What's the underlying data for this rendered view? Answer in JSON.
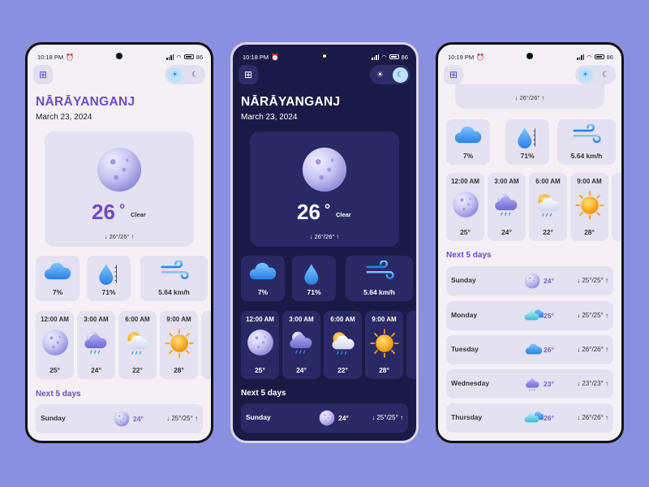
{
  "status": {
    "p1_time": "10:18 PM",
    "p2_time": "10:18 PM",
    "p3_time": "10:19 PM",
    "battery": "86"
  },
  "location": {
    "city": "NĀRĀYANGANJ",
    "date": "March 23, 2024"
  },
  "current": {
    "temp": "26",
    "deg": "°",
    "condition": "Clear",
    "range": "↓ 26°/26° ↑"
  },
  "stats": {
    "cloud": "7%",
    "humidity": "71%",
    "wind": "5.64 km/h"
  },
  "hourly": [
    {
      "time": "12:00 AM",
      "temp": "25°",
      "icon": "moon-icon"
    },
    {
      "time": "3:00 AM",
      "temp": "24°",
      "icon": "cloudy-moon-rain-icon"
    },
    {
      "time": "6:00 AM",
      "temp": "22°",
      "icon": "sun-cloud-rain-icon"
    },
    {
      "time": "9:00 AM",
      "temp": "28°",
      "icon": "sun-icon"
    }
  ],
  "next_title": "Next 5 days",
  "days": [
    {
      "name": "Sunday",
      "temp": "24°",
      "range": "↓ 25°/25° ↑",
      "icon": "moon-icon"
    },
    {
      "name": "Monday",
      "temp": "25°",
      "range": "↓ 25°/25° ↑",
      "icon": "cloudy-icon"
    },
    {
      "name": "Tuesday",
      "temp": "26°",
      "range": "↓ 26°/26° ↑",
      "icon": "cloud-icon"
    },
    {
      "name": "Wednesday",
      "temp": "23°",
      "range": "↓ 23°/23° ↑",
      "icon": "moon-rain-icon"
    },
    {
      "name": "Thursday",
      "temp": "26°",
      "range": "↓ 26°/26° ↑",
      "icon": "cloudy-icon"
    }
  ],
  "colors": {
    "background": "#8b8fdf",
    "accent": "#6e4cc4",
    "dark_bg": "#1b1a47",
    "light_bg": "#f3f1f6"
  }
}
